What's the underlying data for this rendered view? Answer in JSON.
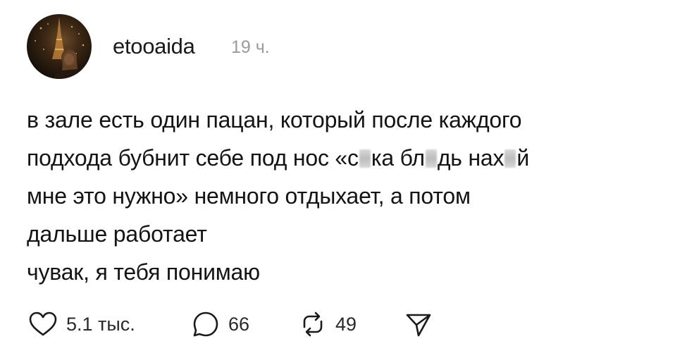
{
  "post": {
    "author": "etooaida",
    "time": "19 ч.",
    "lines": [
      "в зале есть один пацан, который после каждого",
      "мне это нужно» немного отдыхает, а потом",
      "дальше работает",
      "чувак, я тебя понимаю"
    ],
    "line2_segments": [
      "подхода бубнит себе под нос «с",
      "ка бл",
      "дь нах",
      "й"
    ]
  },
  "actions": {
    "likes": "5.1 тыс.",
    "comments": "66",
    "reposts": "49"
  },
  "icons": {
    "like": "heart-icon",
    "comment": "comment-icon",
    "repost": "repost-icon",
    "share": "share-icon"
  },
  "colors": {
    "text": "#141414",
    "muted": "#9a9a9a",
    "background": "#ffffff"
  }
}
